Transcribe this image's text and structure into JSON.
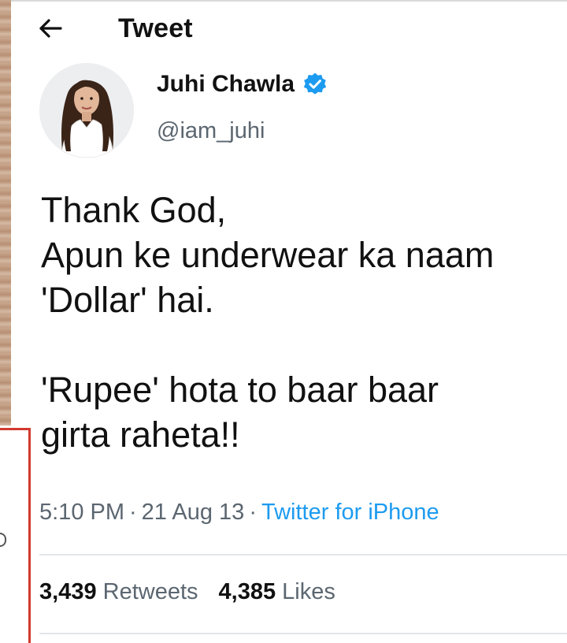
{
  "header": {
    "title": "Tweet",
    "back_icon": "arrow-left-icon"
  },
  "author": {
    "display_name": "Juhi Chawla",
    "handle": "@iam_juhi",
    "verified_icon": "verified-badge-icon",
    "verified_color": "#1d9bf0"
  },
  "tweet": {
    "lines": [
      "Thank God,",
      "Apun ke underwear ka naam",
      "'Dollar' hai.",
      "",
      "'Rupee' hota to baar baar",
      "girta raheta!!"
    ]
  },
  "meta": {
    "time": "5:10 PM",
    "separator": "·",
    "date": "21 Aug 13",
    "source": "Twitter for iPhone",
    "source_color": "#1d9bf0"
  },
  "stats": {
    "retweets_count": "3,439",
    "retweets_label": "Retweets",
    "likes_count": "4,385",
    "likes_label": "Likes"
  }
}
